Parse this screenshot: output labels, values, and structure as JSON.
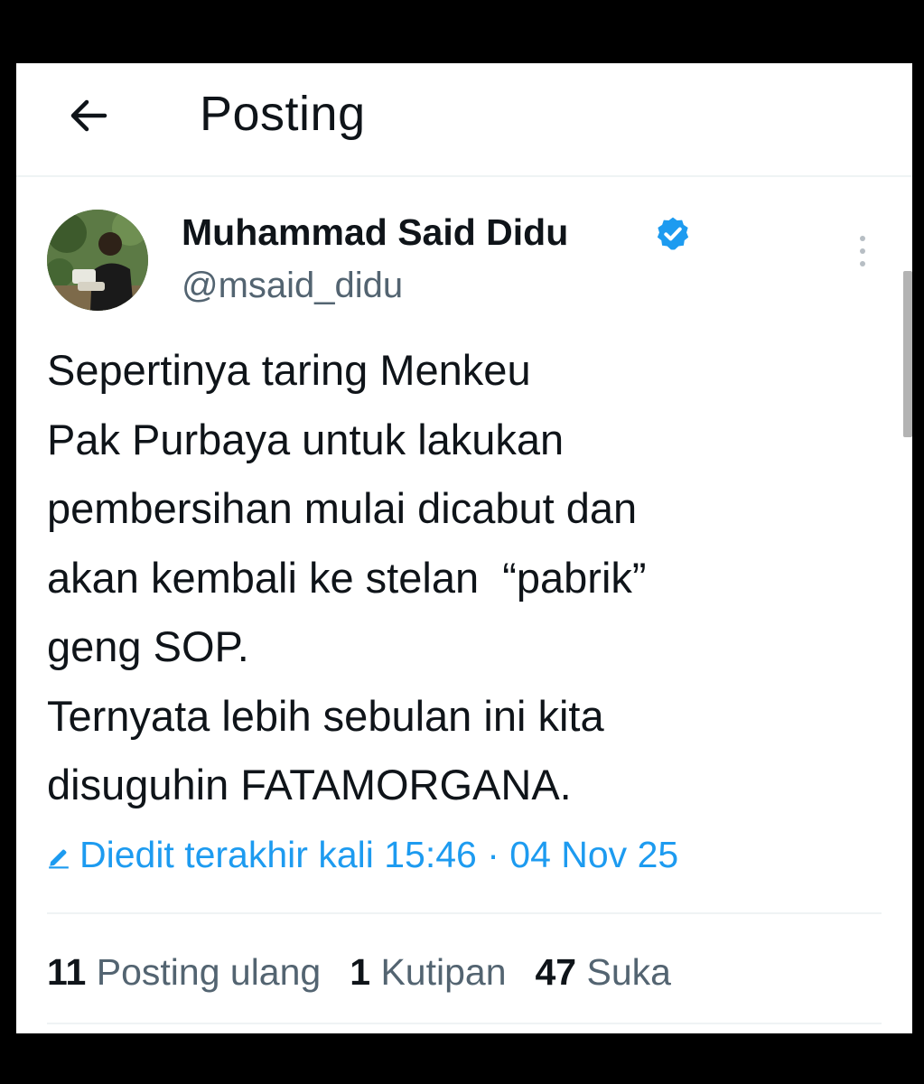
{
  "header": {
    "back_icon": "arrow-left-icon",
    "title": "Posting"
  },
  "author": {
    "avatar_icon": "avatar",
    "name": "Muhammad Said Didu",
    "verified_icon": "verified-badge-icon",
    "verified_color": "#1d9bf0",
    "handle": "@msaid_didu",
    "more_icon": "more-vertical-icon"
  },
  "tweet": {
    "lines": [
      "Sepertinya taring Menkeu",
      "Pak Purbaya untuk lakukan",
      "pembersihan mulai dicabut dan",
      "akan kembali ke stelan  “pabrik”",
      "geng SOP.",
      "Ternyata lebih sebulan ini kita",
      "disuguhin FATAMORGANA."
    ],
    "edited_icon": "pencil-icon",
    "edited_label": "Diedit terakhir kali 15:46 · 04 Nov 25"
  },
  "stats": {
    "reposts_count": "11",
    "reposts_label": "Posting ulang",
    "quotes_count": "1",
    "quotes_label": "Kutipan",
    "likes_count": "47",
    "likes_label": "Suka"
  },
  "colors": {
    "accent": "#1d9bf0",
    "text_primary": "#0f1419",
    "text_secondary": "#536471",
    "border": "#eff3f4",
    "outer_background": "#000000"
  }
}
